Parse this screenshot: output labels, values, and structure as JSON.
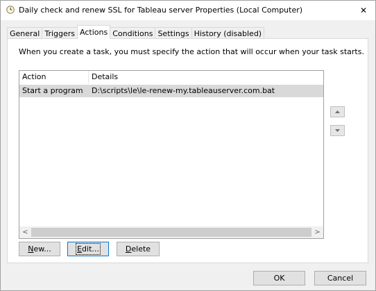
{
  "window": {
    "title": "Daily check and renew SSL for Tableau server Properties (Local Computer)",
    "close_glyph": "✕"
  },
  "tabs": [
    {
      "label": "General",
      "active": false
    },
    {
      "label": "Triggers",
      "active": false
    },
    {
      "label": "Actions",
      "active": true
    },
    {
      "label": "Conditions",
      "active": false
    },
    {
      "label": "Settings",
      "active": false
    },
    {
      "label": "History (disabled)",
      "active": false
    }
  ],
  "actions_panel": {
    "description": "When you create a task, you must specify the action that will occur when your task starts.",
    "columns": {
      "action": "Action",
      "details": "Details"
    },
    "rows": [
      {
        "action": "Start a program",
        "details": "D:\\scripts\\le\\le-renew-my.tableauserver.com.bat",
        "selected": true
      }
    ],
    "scroll_left": "<",
    "scroll_right": ">",
    "buttons": {
      "new_key": "N",
      "new_rest": "ew...",
      "edit_key": "E",
      "edit_rest": "dit...",
      "delete_key": "D",
      "delete_rest": "elete"
    }
  },
  "footer": {
    "ok": "OK",
    "cancel": "Cancel"
  },
  "icons": {
    "title_icon": "clock-icon",
    "move_up": "chevron-up-icon",
    "move_down": "chevron-down-icon"
  }
}
